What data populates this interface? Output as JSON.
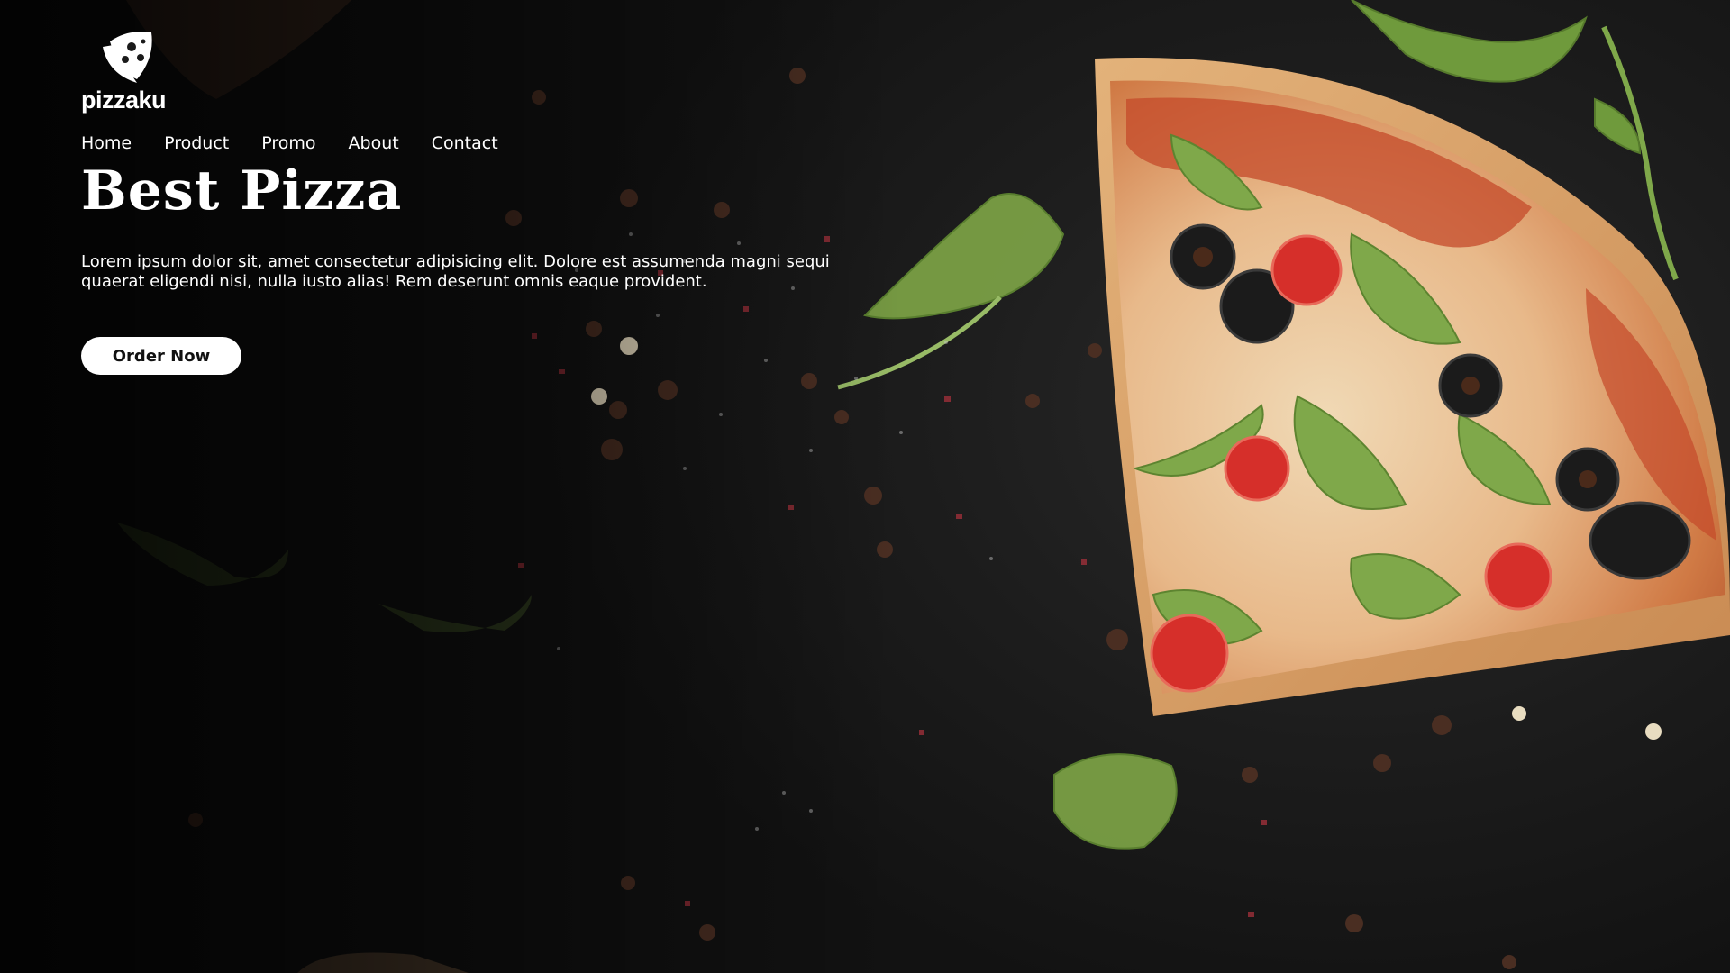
{
  "brand": {
    "name": "pizzaku",
    "logo_icon": "pizza-slice-icon"
  },
  "nav": {
    "items": [
      {
        "label": "Home"
      },
      {
        "label": "Product"
      },
      {
        "label": "Promo"
      },
      {
        "label": "About"
      },
      {
        "label": "Contact"
      }
    ]
  },
  "hero": {
    "title": "Best Pizza",
    "description": "Lorem ipsum dolor sit, amet consectetur adipisicing elit. Dolore est assumenda magni sequi quaerat eligendi nisi, nulla iusto alias! Rem deserunt omnis eaque provident.",
    "cta_label": "Order Now"
  },
  "colors": {
    "background": "#1c1c1c",
    "text": "#ffffff",
    "button_bg": "#ffffff",
    "button_text": "#111111",
    "crust": "#d9a15c",
    "sauce": "#c4492a",
    "arugula": "#7fa84a",
    "olive": "#1a1a1a",
    "tomato": "#d62f2a"
  }
}
